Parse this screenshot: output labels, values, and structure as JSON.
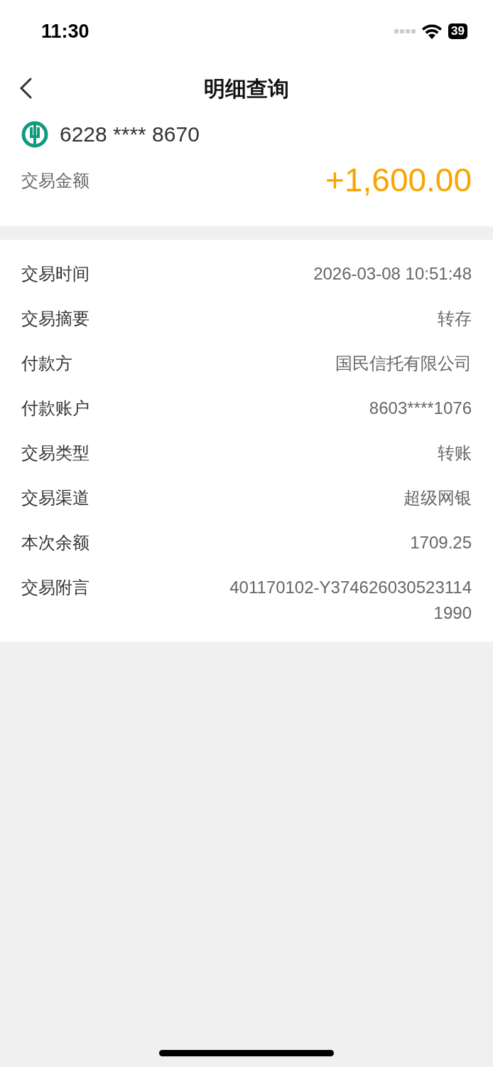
{
  "status_bar": {
    "time": "11:30",
    "battery": "39"
  },
  "nav": {
    "title": "明细查询"
  },
  "account": {
    "number": "6228 **** 8670",
    "amount_label": "交易金额",
    "amount": "+1,600.00"
  },
  "details": [
    {
      "label": "交易时间",
      "value": "2026-03-08 10:51:48"
    },
    {
      "label": "交易摘要",
      "value": "转存"
    },
    {
      "label": "付款方",
      "value": "国民信托有限公司"
    },
    {
      "label": "付款账户",
      "value": "8603****1076"
    },
    {
      "label": "交易类型",
      "value": "转账"
    },
    {
      "label": "交易渠道",
      "value": "超级网银"
    },
    {
      "label": "本次余额",
      "value": "1709.25"
    },
    {
      "label": "交易附言",
      "value": "401170102-Y374626030523114 1990"
    }
  ]
}
